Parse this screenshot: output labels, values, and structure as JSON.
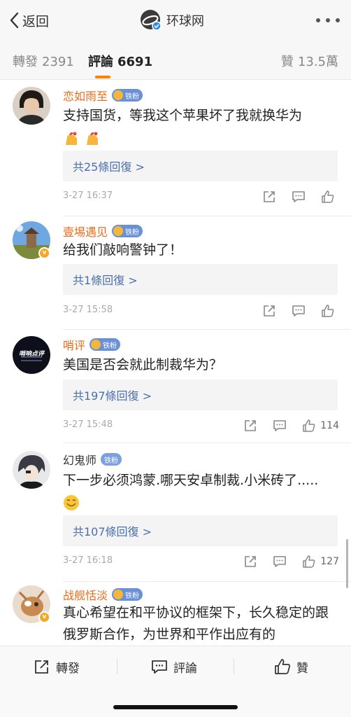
{
  "navbar": {
    "back_label": "返回",
    "title": "环球网"
  },
  "tabs": [
    {
      "label": "轉發",
      "count": "2391",
      "active": false
    },
    {
      "label": "評論",
      "count": "6691",
      "active": true
    },
    {
      "label": "贊",
      "count": "13.5萬",
      "active": false
    }
  ],
  "colors": {
    "accent": "#ff8200",
    "username": "#e86c1c",
    "link": "#4a70b0",
    "fan_badge": "#6a90d8",
    "verified_badge": "#f5a623"
  },
  "comments": [
    {
      "username": "恋如雨至",
      "badge": "铁粉",
      "verified": false,
      "text": "支持国货，等我这个苹果坏了我就换华为",
      "emojis": [
        "cheer-icon",
        "cheer-icon"
      ],
      "replies": "共25條回復 >",
      "time": "3-27 16:37",
      "likes": ""
    },
    {
      "username": "壹埸遇见",
      "badge": "铁粉",
      "verified": true,
      "text": "给我们敲响警钟了！",
      "emojis": [],
      "replies": "共1條回復 >",
      "time": "3-27 15:58",
      "likes": ""
    },
    {
      "username": "哨评",
      "badge": "铁粉",
      "verified": false,
      "avatar_text": "哨响点评",
      "text": "美国是否会就此制裁华为？",
      "emojis": [],
      "replies": "共197條回復 >",
      "time": "3-27 15:48",
      "likes": "114"
    },
    {
      "username": "幻鬼师",
      "badge": "铁粉",
      "verified": false,
      "text": "下一步必须鸿蒙.哪天安卓制裁.小米砖了.....",
      "emojis": [
        "smile-icon"
      ],
      "replies": "共107條回復 >",
      "time": "3-27 16:18",
      "likes": "127"
    },
    {
      "username": "战舰恬淡",
      "badge": "铁粉",
      "verified": true,
      "text": "真心希望在和平协议的框架下，长久稳定的跟俄罗斯合作，为世界和平作出应有的",
      "emojis": [],
      "replies": "",
      "time": "",
      "likes": ""
    }
  ],
  "bottom_bar": {
    "repost_label": "轉發",
    "comment_label": "評論",
    "like_label": "贊"
  }
}
